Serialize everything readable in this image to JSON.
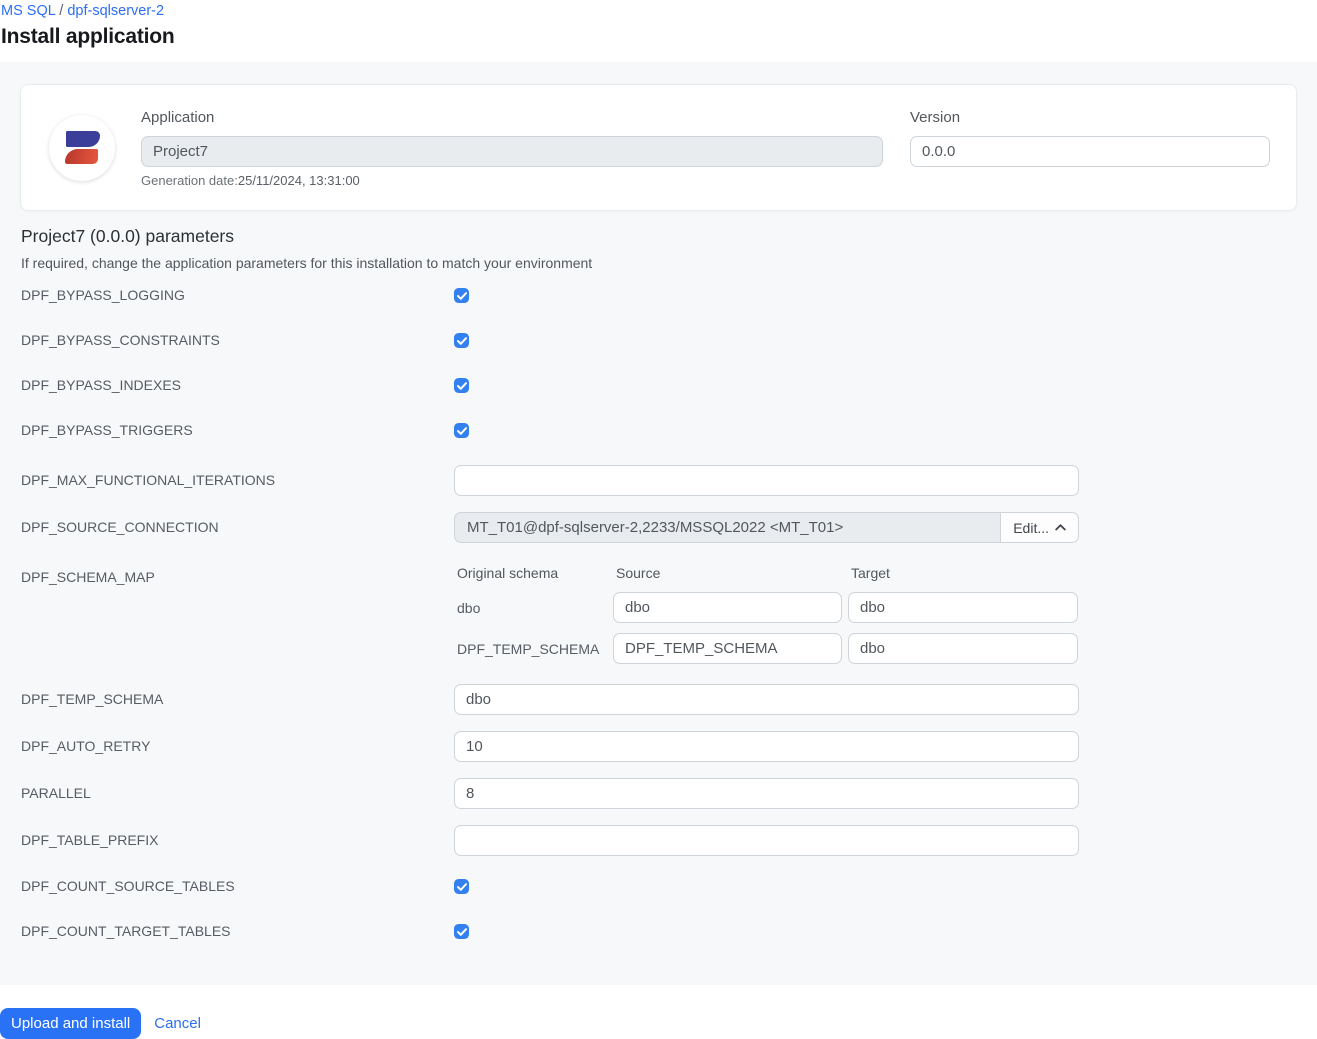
{
  "accent": "#2a72f5",
  "breadcrumb": {
    "items": [
      "MS SQL",
      "dpf-sqlserver-2"
    ],
    "separator": "/"
  },
  "page_title": "Install application",
  "app_card": {
    "application_label": "Application",
    "application_value": "Project7",
    "generation_date_label": "Generation date:",
    "generation_date_value": "25/11/2024, 13:31:00",
    "version_label": "Version",
    "version_value": "0.0.0",
    "logo_colors": {
      "blue": "#3c3f99",
      "red": "#d9452f"
    }
  },
  "parameters_section": {
    "title": "Project7 (0.0.0) parameters",
    "subtitle": "If required, change the application parameters for this installation to match your environment"
  },
  "parameters": [
    {
      "label": "DPF_BYPASS_LOGGING",
      "type": "checkbox",
      "checked": true
    },
    {
      "label": "DPF_BYPASS_CONSTRAINTS",
      "type": "checkbox",
      "checked": true
    },
    {
      "label": "DPF_BYPASS_INDEXES",
      "type": "checkbox",
      "checked": true
    },
    {
      "label": "DPF_BYPASS_TRIGGERS",
      "type": "checkbox",
      "checked": true
    },
    {
      "label": "DPF_MAX_FUNCTIONAL_ITERATIONS",
      "type": "text",
      "value": ""
    },
    {
      "label": "DPF_SOURCE_CONNECTION",
      "type": "connection",
      "value": "MT_T01@dpf-sqlserver-2,2233/MSSQL2022 <MT_T01>",
      "edit_label": "Edit..."
    },
    {
      "label": "DPF_SCHEMA_MAP",
      "type": "schema_map",
      "headers": [
        "Original schema",
        "Source",
        "Target"
      ],
      "rows": [
        {
          "original": "dbo",
          "source": "dbo",
          "target": "dbo"
        },
        {
          "original": "DPF_TEMP_SCHEMA",
          "source": "DPF_TEMP_SCHEMA",
          "target": "dbo"
        }
      ]
    },
    {
      "label": "DPF_TEMP_SCHEMA",
      "type": "text",
      "value": "dbo"
    },
    {
      "label": "DPF_AUTO_RETRY",
      "type": "text",
      "value": "10"
    },
    {
      "label": "PARALLEL",
      "type": "text",
      "value": "8"
    },
    {
      "label": "DPF_TABLE_PREFIX",
      "type": "text",
      "value": ""
    },
    {
      "label": "DPF_COUNT_SOURCE_TABLES",
      "type": "checkbox",
      "checked": true
    },
    {
      "label": "DPF_COUNT_TARGET_TABLES",
      "type": "checkbox",
      "checked": true
    }
  ],
  "footer": {
    "submit_label": "Upload and install",
    "cancel_label": "Cancel"
  }
}
